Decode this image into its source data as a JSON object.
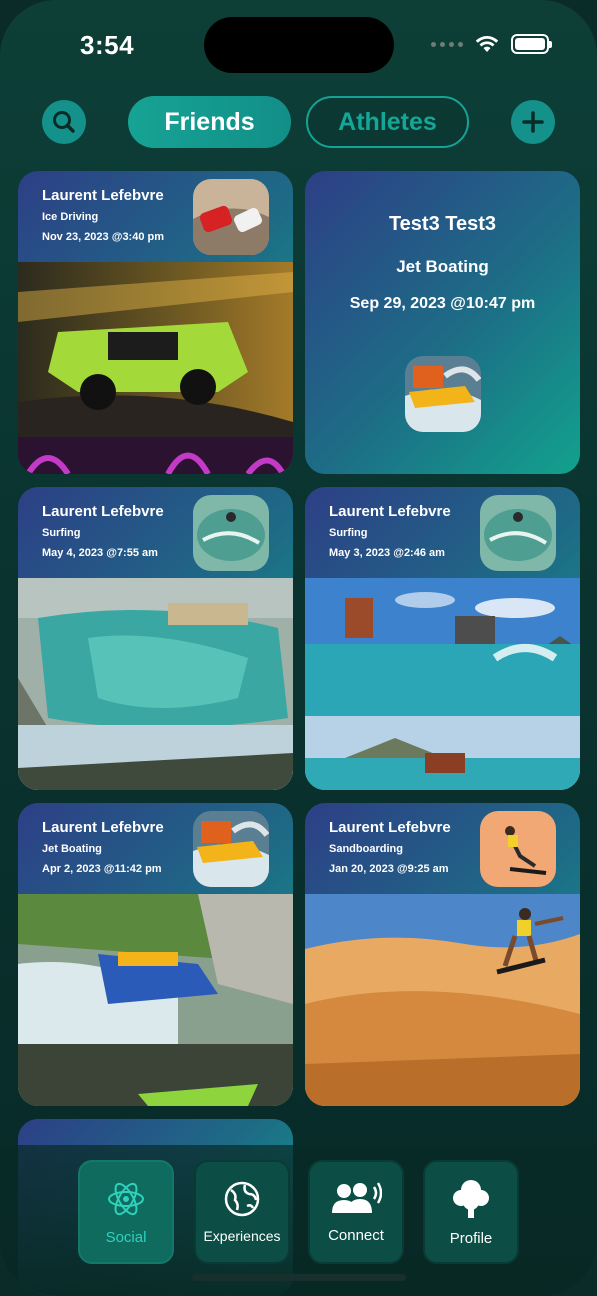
{
  "status": {
    "time": "3:54"
  },
  "tabs": {
    "friends": "Friends",
    "athletes": "Athletes"
  },
  "icons": {
    "search": "search-icon",
    "add": "plus-icon"
  },
  "colors": {
    "accent": "#16a394",
    "background": "#0a3430"
  },
  "feed": [
    {
      "name": "Laurent Lefebvre",
      "sport": "Ice Driving",
      "date": "Nov 23, 2023 @3:40 pm"
    },
    {
      "name": "Test3 Test3",
      "sport": "Jet Boating",
      "date": "Sep 29, 2023 @10:47 pm"
    },
    {
      "name": "Laurent Lefebvre",
      "sport": "Surfing",
      "date": "May 4, 2023 @7:55 am"
    },
    {
      "name": "Laurent Lefebvre",
      "sport": "Surfing",
      "date": "May 3, 2023 @2:46 am"
    },
    {
      "name": "Laurent Lefebvre",
      "sport": "Jet Boating",
      "date": "Apr 2, 2023 @11:42 pm"
    },
    {
      "name": "Laurent Lefebvre",
      "sport": "Sandboarding",
      "date": "Jan 20, 2023 @9:25 am"
    }
  ],
  "nav": [
    {
      "label": "Social",
      "icon": "atom-icon"
    },
    {
      "label": "Experiences",
      "icon": "globe-icon"
    },
    {
      "label": "Connect",
      "icon": "people-icon"
    },
    {
      "label": "Profile",
      "icon": "tree-icon"
    }
  ]
}
